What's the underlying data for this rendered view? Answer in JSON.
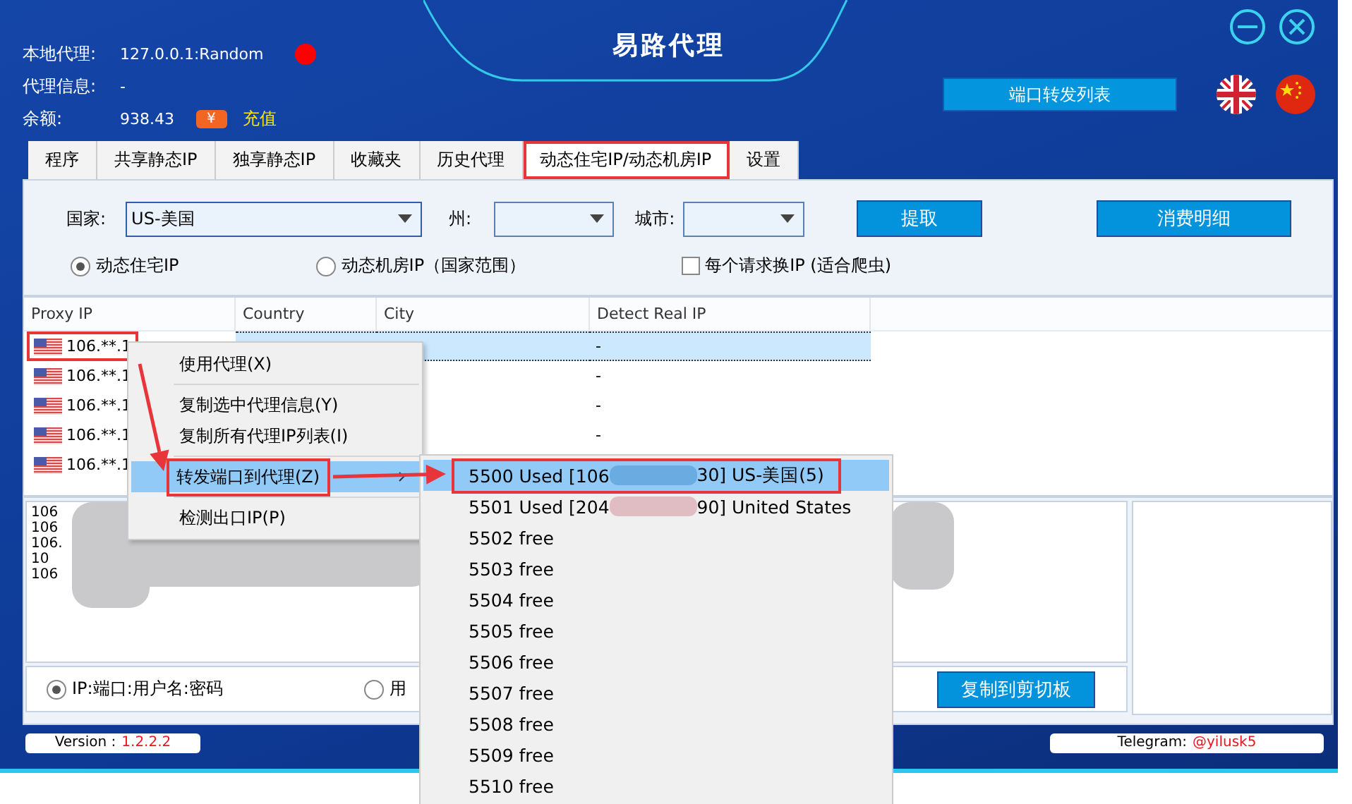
{
  "window": {
    "title": "易路代理"
  },
  "info": [
    {
      "kind": "status",
      "label": "本地代理:",
      "value": "127.0.0.1:Random"
    },
    {
      "kind": "plain",
      "label": "代理信息:",
      "value": "-"
    },
    {
      "kind": "recharge",
      "label": "余额:",
      "value": "938.43",
      "icon_text": "¥",
      "action": "充值"
    }
  ],
  "port_list_button": "端口转发列表",
  "tabs": [
    {
      "label": "程序",
      "selected": false,
      "highlighted": false
    },
    {
      "label": "共享静态IP",
      "selected": false,
      "highlighted": false
    },
    {
      "label": "独享静态IP",
      "selected": false,
      "highlighted": false
    },
    {
      "label": "收藏夹",
      "selected": false,
      "highlighted": false
    },
    {
      "label": "历史代理",
      "selected": false,
      "highlighted": false
    },
    {
      "label": "动态住宅IP/动态机房IP",
      "selected": true,
      "highlighted": true
    },
    {
      "label": "设置",
      "selected": false,
      "highlighted": false
    }
  ],
  "filters": {
    "country_label": "国家:",
    "country": "US-美国",
    "state_label": "州:",
    "city_label": "城市:",
    "fetch_button": "提取",
    "details_button": "消费明细"
  },
  "modes": [
    {
      "label": "动态住宅IP",
      "selected": true
    },
    {
      "label": "动态机房IP（国家范围）",
      "selected": false
    }
  ],
  "rotate_option": {
    "label": "每个请求换IP (适合爬虫)",
    "checked": false
  },
  "table": {
    "columns": [
      "Proxy IP",
      "Country",
      "City",
      "Detect Real IP"
    ],
    "rows": [
      {
        "proxy_ip": "106.**.1",
        "detect": "-",
        "selected": true,
        "highlighted": true
      },
      {
        "proxy_ip": "106.**.1",
        "detect": "-",
        "selected": false,
        "highlighted": false
      },
      {
        "proxy_ip": "106.**.1",
        "detect": "-",
        "selected": false,
        "highlighted": false
      },
      {
        "proxy_ip": "106.**.1",
        "detect": "-",
        "selected": false,
        "highlighted": false
      },
      {
        "proxy_ip": "106.**.1",
        "detect": "",
        "selected": false,
        "highlighted": false
      }
    ]
  },
  "output_lines": [
    "106",
    "106",
    "106.",
    "10",
    "106"
  ],
  "format_options": [
    {
      "label": "IP:端口:用户名:密码",
      "selected": true
    },
    {
      "label": "用",
      "selected": false
    }
  ],
  "copy_button": "复制到剪切板",
  "version": {
    "label": "Version :",
    "value": "1.2.2.2"
  },
  "telegram": {
    "label": "Telegram:",
    "value": "@yilusk5"
  },
  "context_menu": [
    {
      "kind": "item",
      "label": "使用代理(X)",
      "selected": false,
      "highlighted": false
    },
    {
      "kind": "separator"
    },
    {
      "kind": "item",
      "label": "复制选中代理信息(Y)",
      "selected": false,
      "highlighted": false
    },
    {
      "kind": "item",
      "label": "复制所有代理IP列表(I)",
      "selected": false,
      "highlighted": false
    },
    {
      "kind": "separator"
    },
    {
      "kind": "submenu",
      "label": "转发端口到代理(Z)",
      "selected": true,
      "highlighted": true
    },
    {
      "kind": "separator"
    },
    {
      "kind": "item",
      "label": "检测出口IP(P)",
      "selected": false,
      "highlighted": false
    }
  ],
  "port_menu": [
    {
      "kind": "used",
      "before": "5500 Used [106",
      "after": "30] US-美国(5)",
      "selected": true,
      "highlighted": true
    },
    {
      "kind": "used",
      "before": "5501 Used [204",
      "after": "90] United States",
      "selected": false,
      "highlighted": false
    },
    {
      "kind": "free",
      "label": "5502 free",
      "selected": false,
      "highlighted": false
    },
    {
      "kind": "free",
      "label": "5503 free",
      "selected": false,
      "highlighted": false
    },
    {
      "kind": "free",
      "label": "5504 free",
      "selected": false,
      "highlighted": false
    },
    {
      "kind": "free",
      "label": "5505 free",
      "selected": false,
      "highlighted": false
    },
    {
      "kind": "free",
      "label": "5506 free",
      "selected": false,
      "highlighted": false
    },
    {
      "kind": "free",
      "label": "5507 free",
      "selected": false,
      "highlighted": false
    },
    {
      "kind": "free",
      "label": "5508 free",
      "selected": false,
      "highlighted": false
    },
    {
      "kind": "free",
      "label": "5509 free",
      "selected": false,
      "highlighted": false
    },
    {
      "kind": "free",
      "label": "5510 free",
      "selected": false,
      "highlighted": false
    }
  ]
}
